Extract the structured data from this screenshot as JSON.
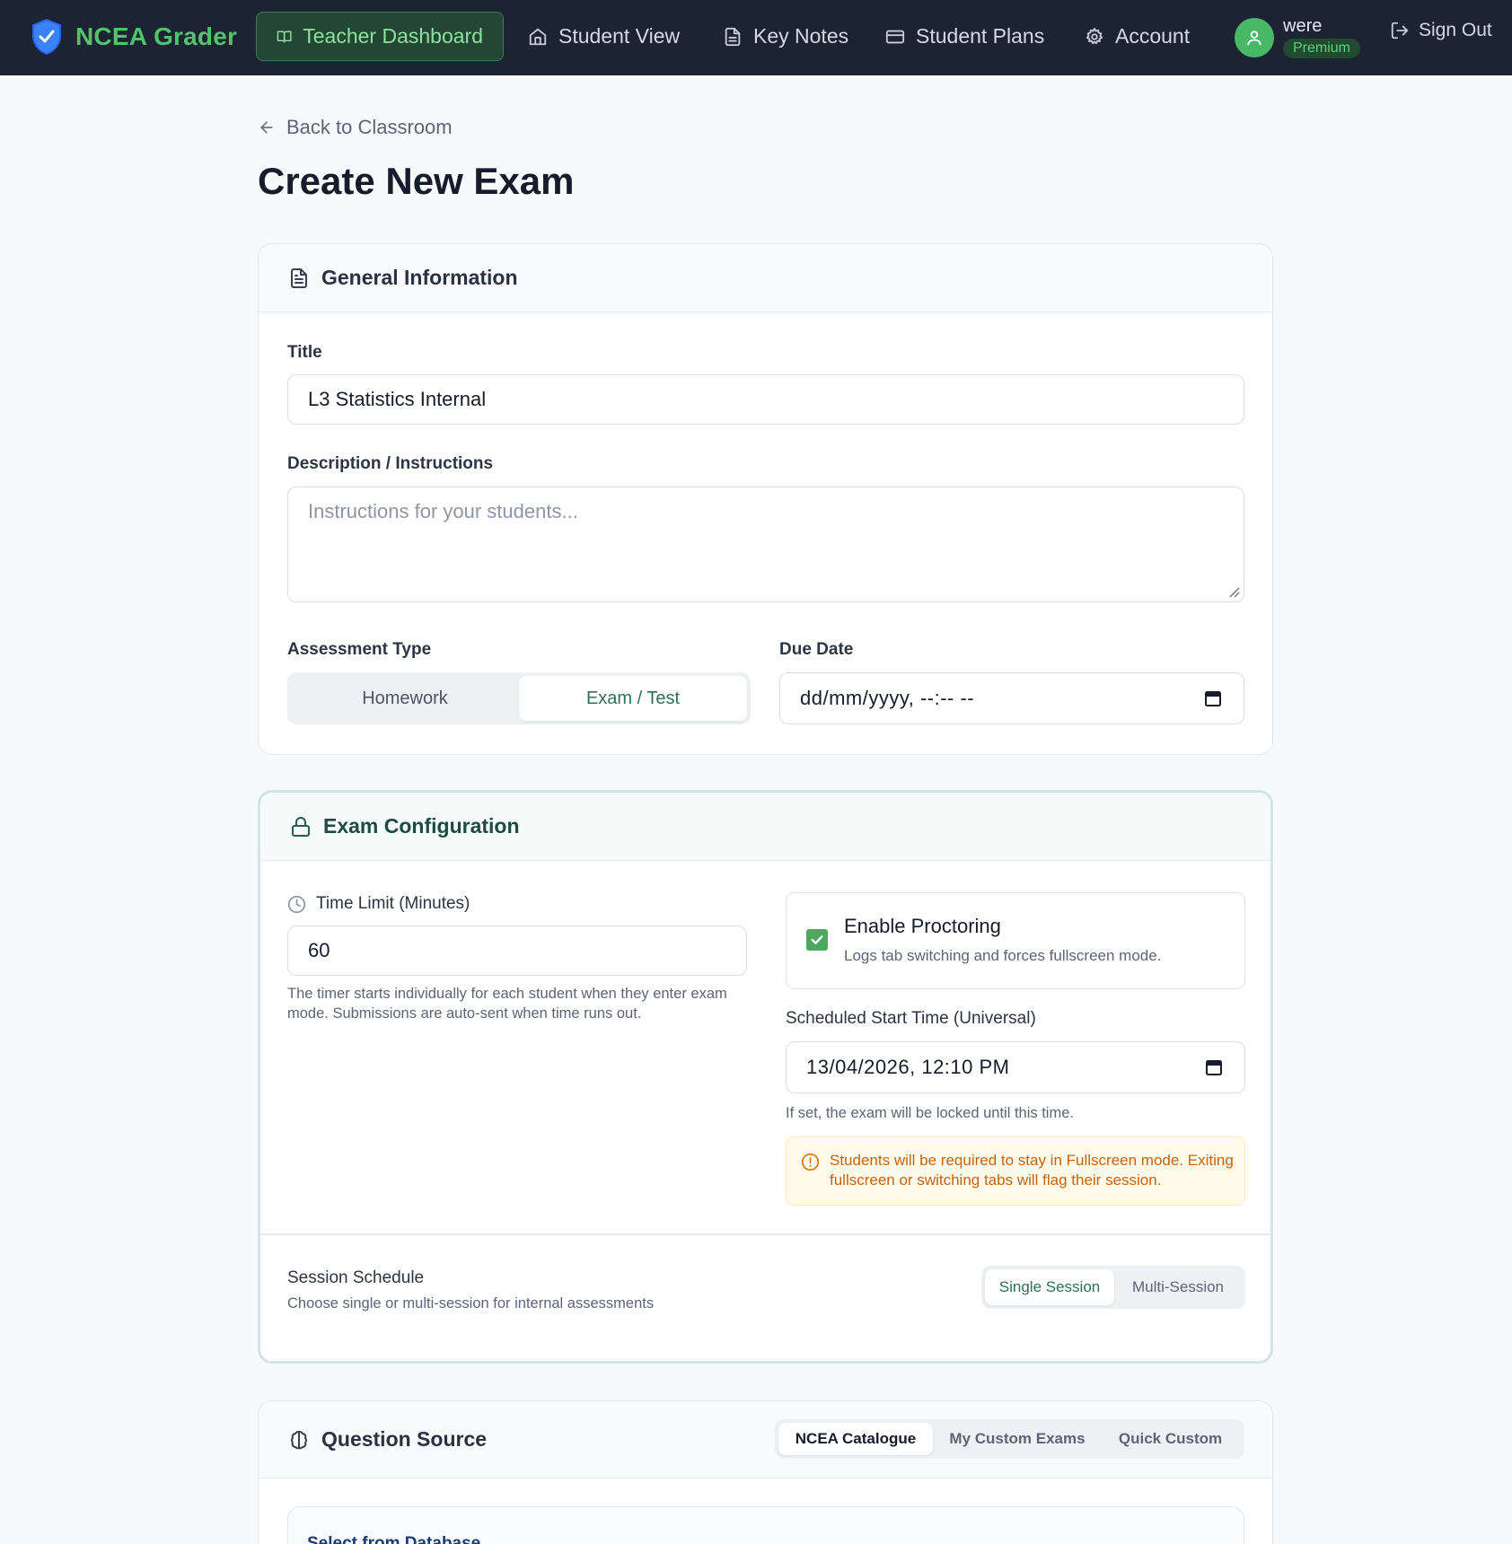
{
  "nav": {
    "brand": "NCEA Grader",
    "items": [
      {
        "label": "Teacher Dashboard",
        "icon": "book-open-icon",
        "active": true
      },
      {
        "label": "Student View",
        "icon": "home-icon",
        "active": false
      },
      {
        "label": "Key Notes",
        "icon": "file-text-icon",
        "active": false
      },
      {
        "label": "Student Plans",
        "icon": "credit-card-icon",
        "active": false
      },
      {
        "label": "Account",
        "icon": "gear-icon",
        "active": false
      }
    ],
    "user": {
      "name": "were",
      "badge": "Premium"
    },
    "signout": "Sign Out"
  },
  "page": {
    "back_label": "Back to Classroom",
    "title": "Create New Exam"
  },
  "general": {
    "heading": "General Information",
    "title_label": "Title",
    "title_value": "L3 Statistics Internal",
    "desc_label": "Description / Instructions",
    "desc_placeholder": "Instructions for your students...",
    "assessment_label": "Assessment Type",
    "assessment_options": [
      "Homework",
      "Exam / Test"
    ],
    "assessment_selected": "Exam / Test",
    "due_label": "Due Date",
    "due_value": "dd/mm/yyyy, --:-- --"
  },
  "config": {
    "heading": "Exam Configuration",
    "time_label": "Time Limit (Minutes)",
    "time_value": "60",
    "time_helper": "The timer starts individually for each student when they enter exam mode. Submissions are auto-sent when time runs out.",
    "proctor_title": "Enable Proctoring",
    "proctor_sub": "Logs tab switching and forces fullscreen mode.",
    "proctor_checked": true,
    "start_label": "Scheduled Start Time (Universal)",
    "start_value": "13/04/2026, 12:10 PM",
    "start_helper": "If set, the exam will be locked until this time.",
    "warning": "Students will be required to stay in Fullscreen mode. Exiting fullscreen or switching tabs will flag their session.",
    "session_title": "Session Schedule",
    "session_sub": "Choose single or multi-session for internal assessments",
    "session_options": [
      "Single Session",
      "Multi-Session"
    ],
    "session_selected": "Single Session"
  },
  "source": {
    "heading": "Question Source",
    "tabs": [
      "NCEA Catalogue",
      "My Custom Exams",
      "Quick Custom"
    ],
    "tab_selected": "NCEA Catalogue",
    "inner_title": "Select from Database"
  },
  "colors": {
    "nav_bg": "#1c2333",
    "brand_green": "#52c26b",
    "accent_teal": "#2f6e58",
    "warning_orange": "#c7620c"
  }
}
